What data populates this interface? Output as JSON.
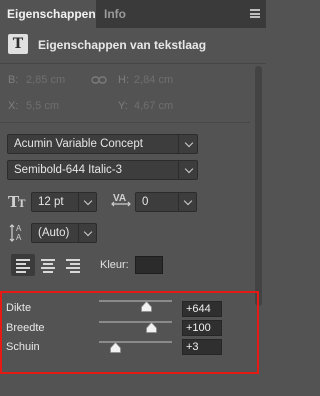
{
  "tabs": [
    {
      "label": "Eigenschappen",
      "active": true
    },
    {
      "label": "Info",
      "active": false
    }
  ],
  "header": {
    "title": "Eigenschappen van tekstlaag"
  },
  "transform": {
    "b_label": "B:",
    "b_value": "2,85 cm",
    "h_label": "H:",
    "h_value": "2,84 cm",
    "x_label": "X:",
    "x_value": "5,5 cm",
    "y_label": "Y:",
    "y_value": "4,67 cm"
  },
  "font": {
    "family": "Acumin Variable Concept",
    "style": "Semibold-644 Italic-3"
  },
  "size": {
    "value": "12 pt"
  },
  "tracking": {
    "value": "0"
  },
  "leading": {
    "value": "(Auto)"
  },
  "color": {
    "label": "Kleur:",
    "swatch": "#2b2b2b"
  },
  "variable_axes": [
    {
      "label": "Dikte",
      "value": "+644",
      "fraction": 0.65
    },
    {
      "label": "Breedte",
      "value": "+100",
      "fraction": 0.72
    },
    {
      "label": "Schuin",
      "value": "+3",
      "fraction": 0.22
    }
  ],
  "accent": {
    "highlight": "#e31b14"
  }
}
